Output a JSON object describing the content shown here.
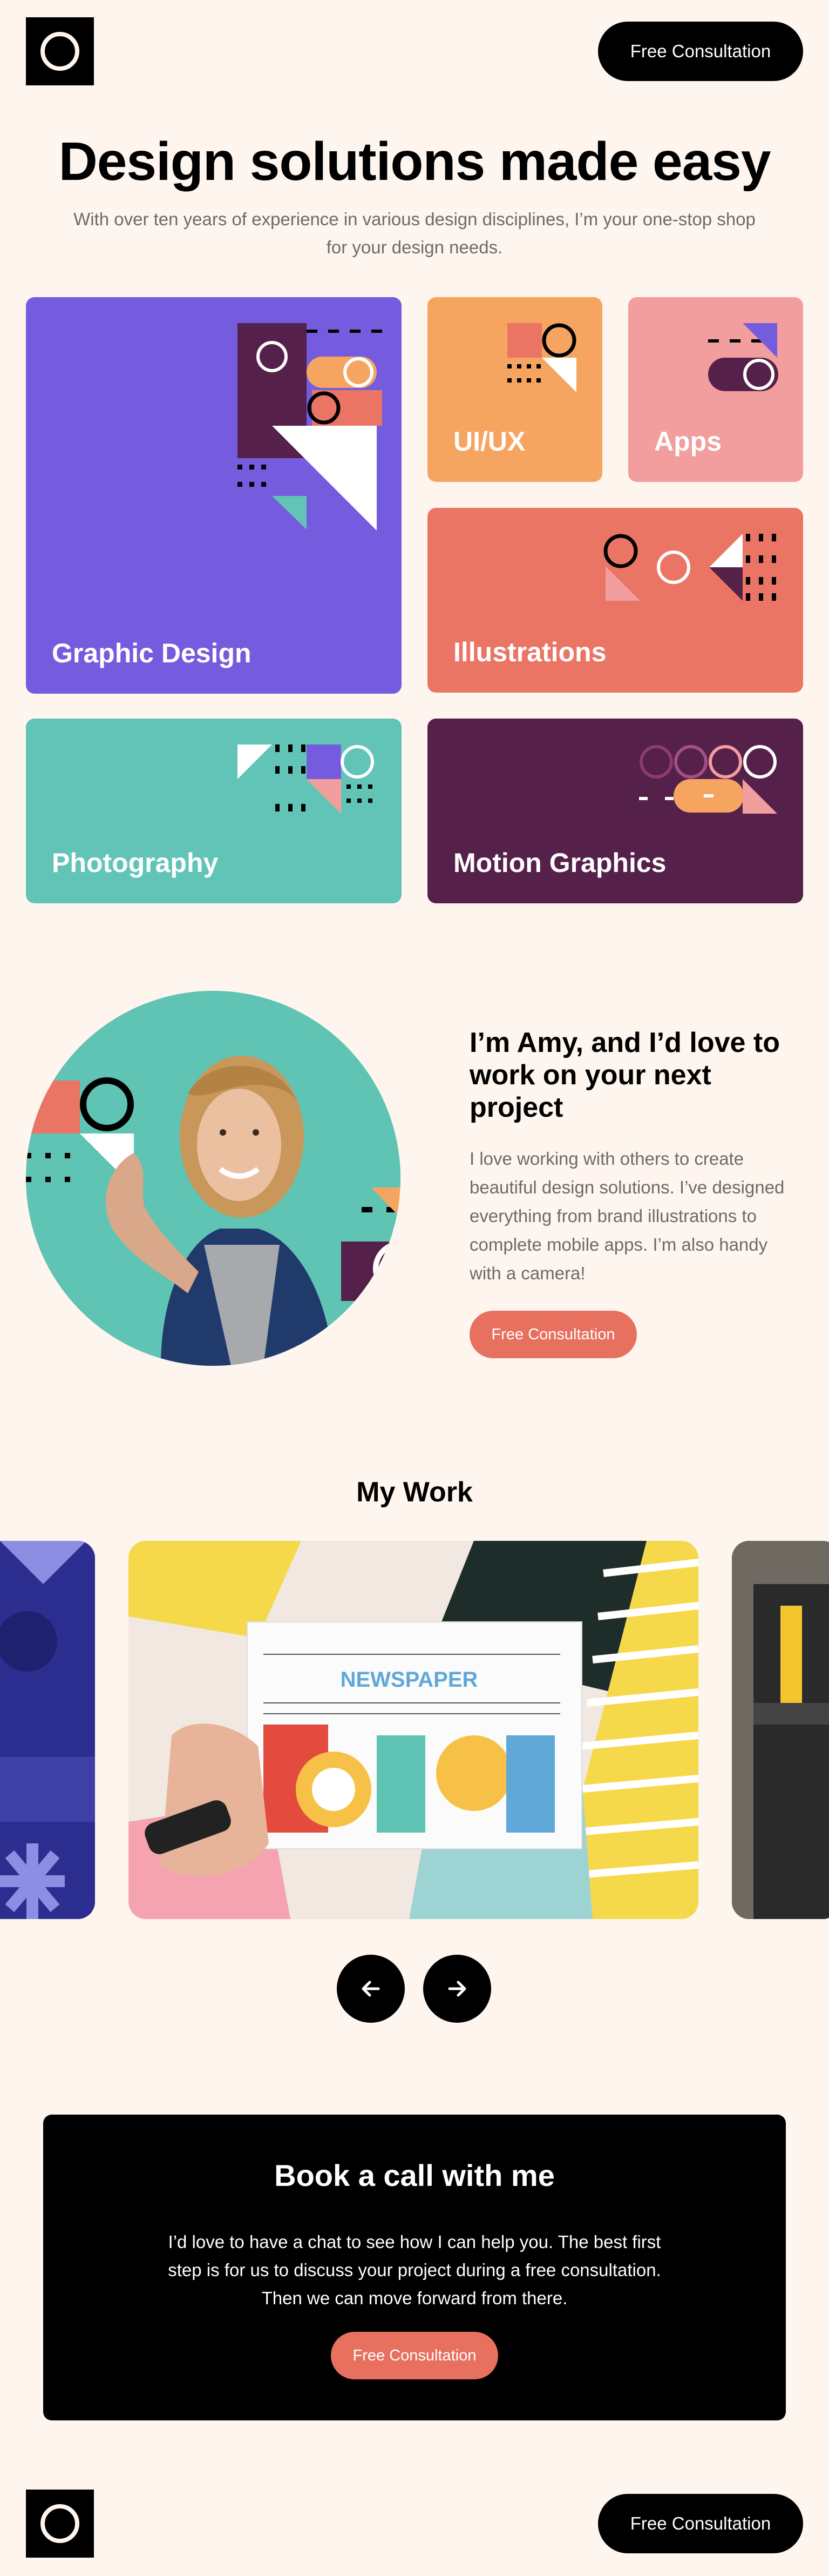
{
  "header": {
    "cta_label": "Free Consultation"
  },
  "hero": {
    "title": "Design solutions made easy",
    "subtitle": "With over ten years of experience in various design disciplines, I’m your one-stop shop for your design needs."
  },
  "services": [
    {
      "label": "Graphic Design",
      "color": "#755CDE"
    },
    {
      "label": "UI/UX",
      "color": "#F6A560"
    },
    {
      "label": "Apps",
      "color": "#F39E9E"
    },
    {
      "label": "Illustrations",
      "color": "#EB7565"
    },
    {
      "label": "Photography",
      "color": "#61C4B7"
    },
    {
      "label": "Motion Graphics",
      "color": "#552049"
    }
  ],
  "about": {
    "title": "I’m Amy, and I’d love to work on your next project",
    "text": "I love working with others to create beautiful design solutions. I’ve designed everything from brand illustrations to complete mobile apps. I’m also handy with a camera!",
    "cta_label": "Free Consultation"
  },
  "work": {
    "title": "My Work",
    "prev_icon": "arrow-left-icon",
    "next_icon": "arrow-right-icon",
    "newspaper_text": "NEWSPAPER"
  },
  "cta": {
    "title": "Book a call with me",
    "text": "I’d love to have a chat to see how I can help you. The best first step is for us to discuss your project during a free consultation. Then we can move forward from there.",
    "button_label": "Free Consultation"
  },
  "footer": {
    "cta_label": "Free Consultation"
  },
  "colors": {
    "background": "#FEF5EE",
    "coral": "#E7705F",
    "purple": "#755CDE",
    "plum": "#552049",
    "teal": "#61C4B7",
    "orange": "#F6A560",
    "pink": "#F39E9E"
  }
}
